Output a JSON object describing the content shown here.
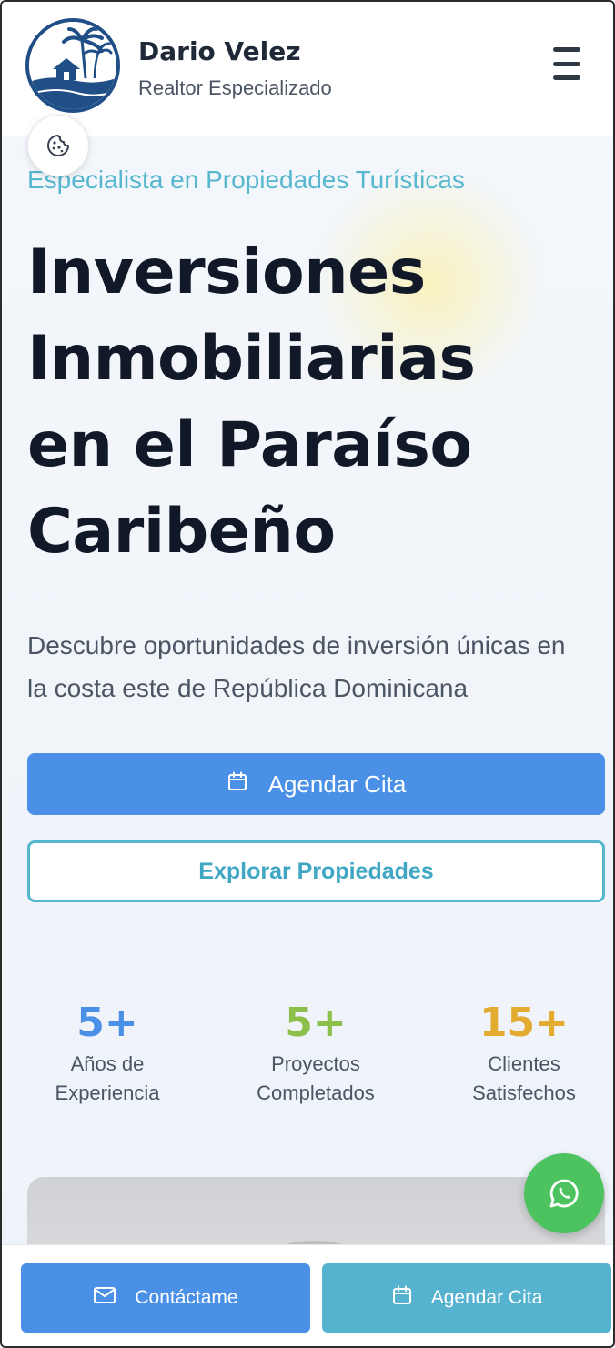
{
  "header": {
    "name": "Dario Velez",
    "subtitle": "Realtor Especializado",
    "logo_icon": "palm-island-logo",
    "menu_icon": "hamburger-menu-icon",
    "cookie_icon": "cookie-icon"
  },
  "hero": {
    "eyebrow": "Especialista en Propiedades Turísticas",
    "title_lines": [
      "Inversiones",
      "Inmobiliarias",
      "en el Paraíso",
      "Caribeño"
    ],
    "subtitle": "Descubre oportunidades de inversión únicas en la costa este de República Dominicana",
    "primary_button": "Agendar Cita",
    "secondary_button": "Explorar Propiedades"
  },
  "stats": [
    {
      "value": "5+",
      "label_lines": [
        "Años de",
        "Experiencia"
      ],
      "color": "#4a90e6"
    },
    {
      "value": "5+",
      "label_lines": [
        "Proyectos",
        "Completados"
      ],
      "color": "#8cc04a"
    },
    {
      "value": "15+",
      "label_lines": [
        "Clientes",
        "Satisfechos"
      ],
      "color": "#e3ab2f"
    }
  ],
  "floating": {
    "whatsapp_icon": "whatsapp-icon"
  },
  "bottom_bar": {
    "contact_label": "Contáctame",
    "agenda_label": "Agendar Cita"
  },
  "colors": {
    "primary": "#4a90e6",
    "accent": "#56b7cf",
    "whatsapp": "#4cc35e",
    "title": "#111827"
  }
}
